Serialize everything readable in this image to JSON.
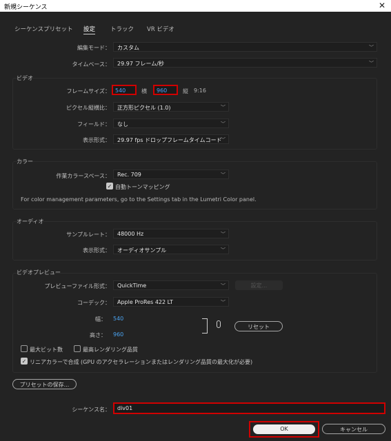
{
  "window": {
    "title": "新規シーケンス"
  },
  "tabs": [
    "シーケンスプリセット",
    "設定",
    "トラック",
    "VR ビデオ"
  ],
  "edit_mode": {
    "label": "編集モード：",
    "value": "カスタム"
  },
  "timebase": {
    "label": "タイムベース：",
    "value": "29.97  フレーム/秒"
  },
  "video": {
    "title": "ビデオ",
    "frame_size_label": "フレームサイズ：",
    "width": "540",
    "h_label": "横",
    "height": "960",
    "v_label": "縦",
    "ratio": "9:16",
    "pixel_aspect_label": "ピクセル縦横比：",
    "pixel_aspect": "正方形ピクセル (1.0)",
    "fields_label": "フィールド：",
    "fields": "なし",
    "display_format_label": "表示形式：",
    "display_format": "29.97  fps  ドロップフレームタイムコード"
  },
  "color": {
    "title": "カラー",
    "working_space_label": "作業カラースペース：",
    "working_space": "Rec. 709",
    "auto_tone_mapping": "自動トーンマッピング",
    "note": "For color management parameters, go to the Settings tab in the Lumetri Color panel."
  },
  "audio": {
    "title": "オーディオ",
    "sample_rate_label": "サンプルレート：",
    "sample_rate": "48000 Hz",
    "display_format_label": "表示形式：",
    "display_format": "オーディオサンプル"
  },
  "preview": {
    "title": "ビデオプレビュー",
    "file_format_label": "プレビューファイル形式：",
    "file_format": "QuickTime",
    "settings_button": "設定...",
    "codec_label": "コーデック：",
    "codec": "Apple ProRes 422 LT",
    "width_label": "幅：",
    "width": "540",
    "height_label": "高さ：",
    "height": "960",
    "reset_button": "リセット",
    "max_bit_depth": "最大ビット数",
    "max_render_quality": "最高レンダリング品質",
    "linear_color": "リニアカラーで合成 (GPU のアクセラレーションまたはレンダリング品質の最大化が必要)"
  },
  "save_preset_button": "プリセットの保存...",
  "sequence_name": {
    "label": "シーケンス名：",
    "value": "div01"
  },
  "buttons": {
    "ok": "OK",
    "cancel": "キャンセル"
  }
}
